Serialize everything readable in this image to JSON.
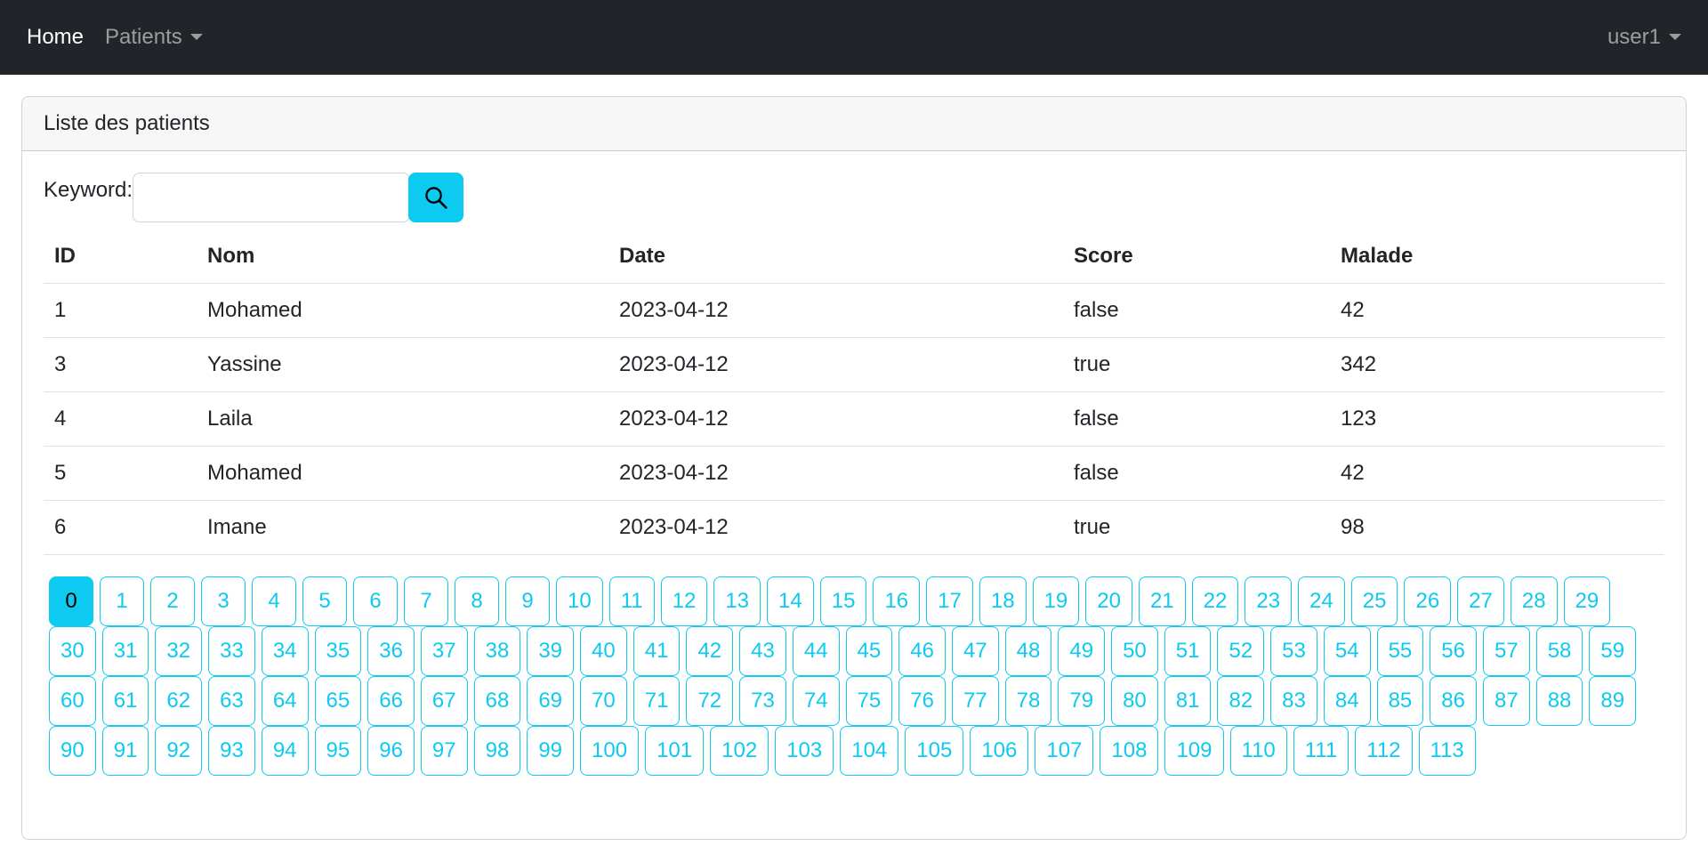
{
  "navbar": {
    "home": "Home",
    "patients": "Patients",
    "user": "user1"
  },
  "card": {
    "header": "Liste des patients"
  },
  "search": {
    "label": "Keyword:",
    "value": ""
  },
  "table": {
    "headers": [
      "ID",
      "Nom",
      "Date",
      "Score",
      "Malade"
    ],
    "rows": [
      [
        "1",
        "Mohamed",
        "2023-04-12",
        "false",
        "42"
      ],
      [
        "3",
        "Yassine",
        "2023-04-12",
        "true",
        "342"
      ],
      [
        "4",
        "Laila",
        "2023-04-12",
        "false",
        "123"
      ],
      [
        "5",
        "Mohamed",
        "2023-04-12",
        "false",
        "42"
      ],
      [
        "6",
        "Imane",
        "2023-04-12",
        "true",
        "98"
      ]
    ]
  },
  "pagination": {
    "current": 0,
    "first": 0,
    "last": 113
  },
  "colors": {
    "accent": "#0dcaf0",
    "navbar": "#212529"
  }
}
